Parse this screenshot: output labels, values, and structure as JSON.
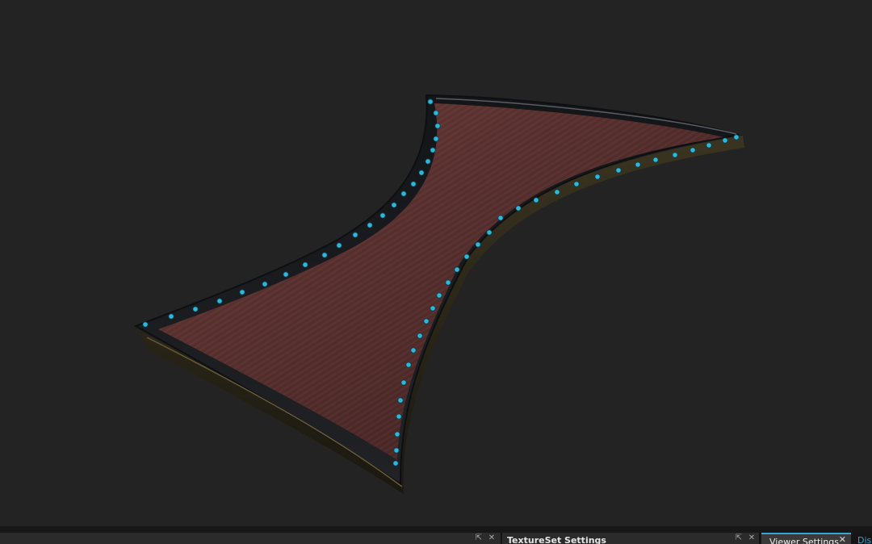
{
  "viewport": {
    "object": "bowtie-shaped wooden plank with metal rim and cyan studs",
    "background_color": "#232323",
    "accent_color": "#33b4d8"
  },
  "panels": {
    "left": {
      "icons": [
        "pop-out-icon",
        "close-icon"
      ]
    },
    "textureset": {
      "title": "TextureSet Settings",
      "icons": [
        "pop-out-icon",
        "close-icon"
      ]
    }
  },
  "tabs": {
    "viewer_settings": {
      "label": "Viewer Settings",
      "active": true,
      "close_icon": "close-icon"
    },
    "display": {
      "label": "Disp"
    }
  },
  "colors": {
    "active_tab_accent": "#33a7d6",
    "panel_bg": "#2b2b2b",
    "text": "#e6e6e6"
  }
}
